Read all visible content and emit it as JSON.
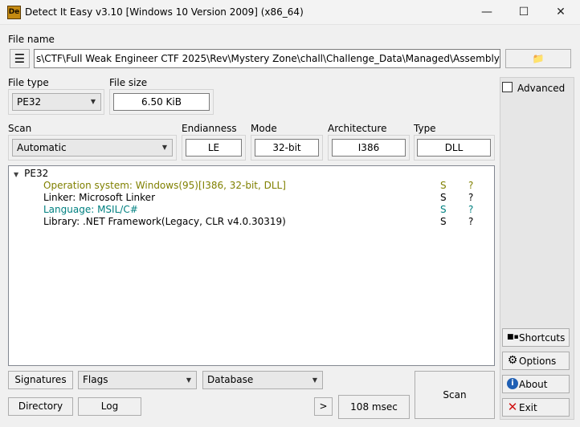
{
  "window": {
    "title": "Detect It Easy v3.10 [Windows 10 Version 2009] (x86_64)",
    "icon_text": "De",
    "minimize_glyph": "—",
    "maximize_glyph": "☐",
    "close_glyph": "✕"
  },
  "file": {
    "label": "File name",
    "path": "s\\CTF\\Full Weak Engineer CTF 2025\\Rev\\Mystery Zone\\chall\\Challenge_Data\\Managed\\Assembly-CSharp.dll",
    "menu_glyph": "☰",
    "open_glyph": "📁"
  },
  "file_type": {
    "label": "File type",
    "value": "PE32"
  },
  "file_size": {
    "label": "File size",
    "value": "6.50 KiB"
  },
  "advanced": {
    "label": "Advanced",
    "checked": false
  },
  "scan": {
    "label": "Scan",
    "value": "Automatic"
  },
  "endianness": {
    "label": "Endianness",
    "value": "LE"
  },
  "mode": {
    "label": "Mode",
    "value": "32-bit"
  },
  "architecture": {
    "label": "Architecture",
    "value": "I386"
  },
  "type": {
    "label": "Type",
    "value": "DLL"
  },
  "results": {
    "root": "PE32",
    "items": [
      {
        "text": "Operation system: Windows(95)[I386, 32-bit, DLL]",
        "flag": "S",
        "q": "?",
        "color": "#808000"
      },
      {
        "text": "Linker: Microsoft Linker",
        "flag": "S",
        "q": "?",
        "color": "#000000"
      },
      {
        "text": "Language: MSIL/C#",
        "flag": "S",
        "q": "?",
        "color": "#008080"
      },
      {
        "text": "Library: .NET Framework(Legacy, CLR v4.0.30319)",
        "flag": "S",
        "q": "?",
        "color": "#000000"
      }
    ]
  },
  "sidebar": {
    "shortcuts": "Shortcuts",
    "options": "Options",
    "about": "About",
    "exit": "Exit"
  },
  "bottom": {
    "signatures": "Signatures",
    "flags": "Flags",
    "database": "Database",
    "directory": "Directory",
    "log": "Log",
    "more": ">",
    "time": "108 msec",
    "scan": "Scan"
  }
}
